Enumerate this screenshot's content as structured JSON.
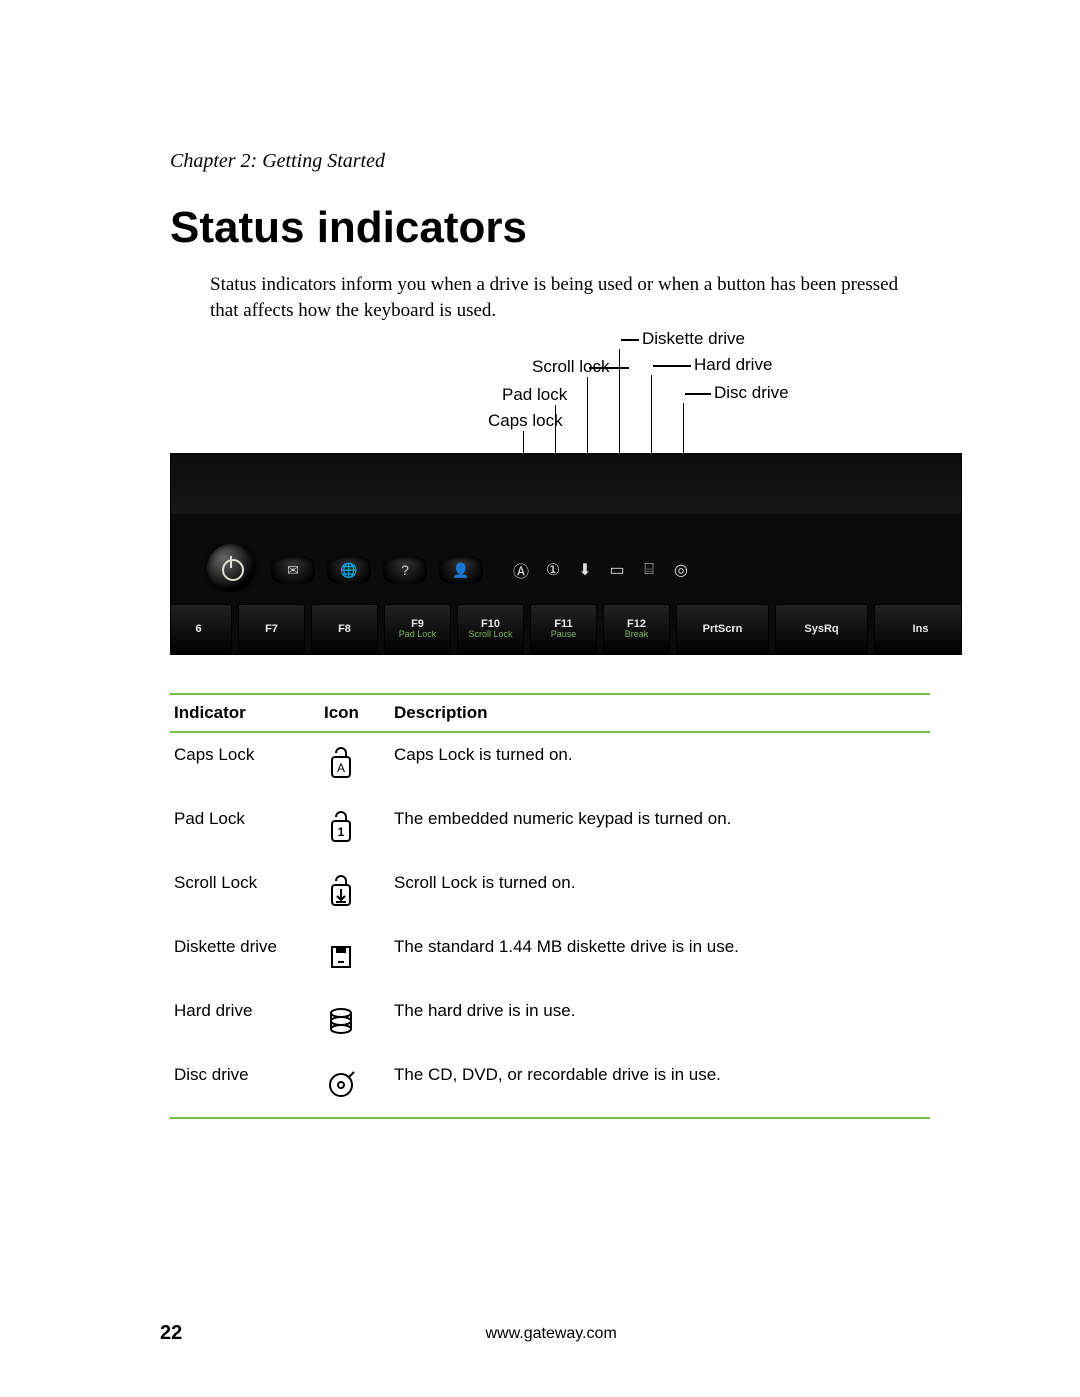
{
  "chapter": "Chapter 2: Getting Started",
  "title": "Status indicators",
  "intro": "Status indicators inform you when a drive is being used or when a button has been pressed that affects how the keyboard is used.",
  "callouts": {
    "caps": "Caps lock",
    "pad": "Pad lock",
    "scroll": "Scroll lock",
    "diskette": "Diskette drive",
    "hard": "Hard drive",
    "disc": "Disc drive"
  },
  "shortcut_icons": [
    "✉",
    "🌐",
    "?",
    "👤"
  ],
  "indicator_icons": [
    "Ⓐ",
    "①",
    "⬇",
    "▭",
    "⌸",
    "◎"
  ],
  "keys": [
    {
      "main": "6",
      "sub": ""
    },
    {
      "main": "F7",
      "sub": ""
    },
    {
      "main": "F8",
      "sub": ""
    },
    {
      "main": "F9",
      "sub": "Pad Lock"
    },
    {
      "main": "F10",
      "sub": "Scroll Lock"
    },
    {
      "main": "F11",
      "sub": "Pause"
    },
    {
      "main": "F12",
      "sub": "Break"
    },
    {
      "main": "PrtScrn",
      "sub": ""
    },
    {
      "main": "SysRq",
      "sub": ""
    },
    {
      "main": "Ins",
      "sub": ""
    }
  ],
  "table": {
    "headers": {
      "indicator": "Indicator",
      "icon": "Icon",
      "description": "Description"
    },
    "rows": [
      {
        "indicator": "Caps Lock",
        "icon": "capslock",
        "description": "Caps Lock is turned on."
      },
      {
        "indicator": "Pad Lock",
        "icon": "padlock",
        "description": "The embedded numeric keypad is turned on."
      },
      {
        "indicator": "Scroll Lock",
        "icon": "scrolllock",
        "description": "Scroll Lock is turned on."
      },
      {
        "indicator": "Diskette drive",
        "icon": "diskette",
        "description": "The standard 1.44 MB diskette drive is in use."
      },
      {
        "indicator": "Hard drive",
        "icon": "harddrive",
        "description": "The hard drive is in use."
      },
      {
        "indicator": "Disc drive",
        "icon": "discdrive",
        "description": "The CD, DVD, or recordable drive is in use."
      }
    ]
  },
  "footer": {
    "page": "22",
    "url": "www.gateway.com"
  }
}
